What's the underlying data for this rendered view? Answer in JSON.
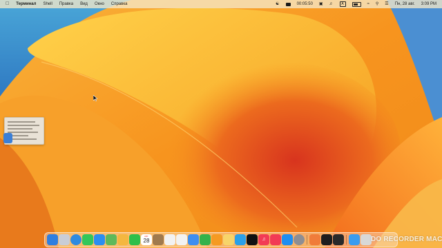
{
  "menubar": {
    "apple_icon": "apple-logo-icon",
    "app_name": "Терминал",
    "menus": [
      "Shell",
      "Правка",
      "Вид",
      "Окно",
      "Справка"
    ],
    "status": {
      "timer": "00:05:50",
      "input_source": "A",
      "date": "Пн, 28 авг.",
      "time": "3:09 PM"
    }
  },
  "dock": {
    "apps": [
      {
        "icon": "finder-icon",
        "color": "#2f7fe0"
      },
      {
        "icon": "launchpad-icon",
        "color": "#c9cdd6"
      },
      {
        "icon": "safari-icon",
        "color": "#2f8be0"
      },
      {
        "icon": "messages-icon",
        "color": "#34c759"
      },
      {
        "icon": "mail-icon",
        "color": "#2b8ef0"
      },
      {
        "icon": "maps-icon",
        "color": "#5fb95a"
      },
      {
        "icon": "photos-icon",
        "color": "#f4b740"
      },
      {
        "icon": "facetime-icon",
        "color": "#2fbf4a"
      },
      {
        "icon": "calendar-icon",
        "color": "#ffffff"
      },
      {
        "icon": "contacts-icon",
        "color": "#a07a4e"
      },
      {
        "icon": "reminders-icon",
        "color": "#f2f2f2"
      },
      {
        "icon": "freeform-icon",
        "color": "#f2f2f2"
      },
      {
        "icon": "keynote-icon",
        "color": "#3d8ef0"
      },
      {
        "icon": "numbers-icon",
        "color": "#34b24a"
      },
      {
        "icon": "pages-icon",
        "color": "#f59a22"
      },
      {
        "icon": "notes-icon",
        "color": "#f7d46a"
      },
      {
        "icon": "chat-icon",
        "color": "#2aa0e8"
      },
      {
        "icon": "apple-tv-icon",
        "color": "#111111"
      },
      {
        "icon": "music-icon",
        "color": "#f23a55"
      },
      {
        "icon": "news-icon",
        "color": "#f23a55"
      },
      {
        "icon": "app-store-icon",
        "color": "#1f8ef1"
      },
      {
        "icon": "system-settings-icon",
        "color": "#8e8e93"
      },
      {
        "icon": "recorder-app-icon",
        "color": "#f07c3a"
      },
      {
        "icon": "terminal-icon",
        "color": "#1e1e1e"
      },
      {
        "icon": "screen-recorder-icon",
        "color": "#2a2a2a"
      },
      {
        "icon": "downloads-folder-icon",
        "color": "#3a9cf0"
      },
      {
        "icon": "trash-icon",
        "color": "#d8d8d8"
      }
    ],
    "calendar_month": "АВГ.",
    "calendar_day": "28"
  },
  "watermark": "DO RECORDER MAC"
}
